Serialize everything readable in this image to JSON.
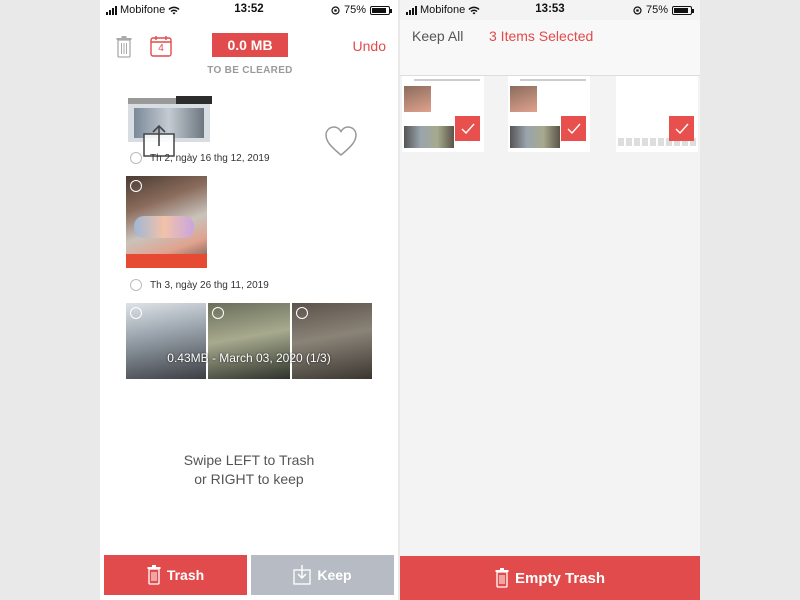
{
  "left_screen": {
    "status": {
      "carrier": "Mobifone",
      "time": "13:52",
      "battery": "75%",
      "battery_level": 0.75
    },
    "header": {
      "size": "0.0 MB",
      "size_caption": "TO BE CLEARED",
      "undo": "Undo",
      "calendar_day": "4"
    },
    "groups": [
      {
        "date": "Th 2, ngày 16 thg 12, 2019"
      },
      {
        "date": "Th 3, ngày 26 thg 11, 2019"
      }
    ],
    "strip_caption": "0.43MB - March 03, 2020 (1/3)",
    "hint_line1": "Swipe LEFT to Trash",
    "hint_line2": "or RIGHT to keep",
    "trash_label": "Trash",
    "keep_label": "Keep",
    "colors": {
      "accent": "#e14b4b",
      "keep_button": "#b7bcc4"
    }
  },
  "right_screen": {
    "status": {
      "carrier": "Mobifone",
      "time": "13:53",
      "battery": "75%",
      "battery_level": 0.75
    },
    "keep_all": "Keep All",
    "selection_count": "3 Items Selected",
    "empty_trash": "Empty Trash"
  }
}
